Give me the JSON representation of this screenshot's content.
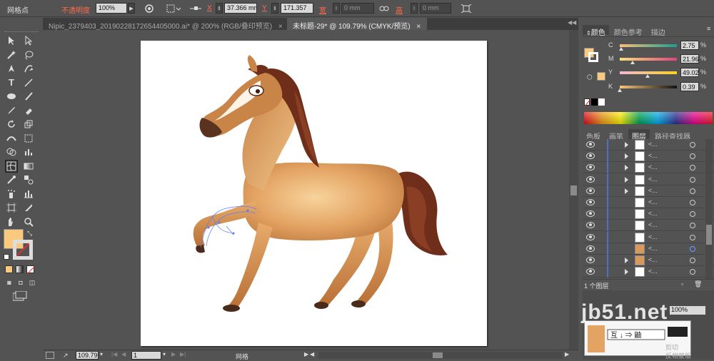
{
  "control_bar": {
    "tool_name": "网格点",
    "opacity_label": "不透明度",
    "opacity_value": "100%",
    "x_label": "X",
    "x_value": "37.366 mm",
    "y_label": "Y",
    "y_value": "171.357",
    "w_label": "宽",
    "w_value": "0 mm",
    "h_label": "高",
    "h_value": "0 mm"
  },
  "doc_tabs": [
    {
      "label": "Nipic_2379403_20190228172654405000.ai* @ 200% (RGB/叠印预览)",
      "close": "×"
    },
    {
      "label": "未标题-29* @ 109.79% (CMYK/预览)",
      "close": "×"
    }
  ],
  "status_bar": {
    "zoom": "109.79",
    "page": "1",
    "tool": "网格"
  },
  "color_panel": {
    "tabs": [
      "颜色",
      "颜色参考",
      "描边"
    ],
    "channels": [
      {
        "label": "C",
        "value": "2.75",
        "fraction": 0.0275,
        "grad_from": "#f7c07a",
        "grad_to": "#1f9e8f"
      },
      {
        "label": "M",
        "value": "21.96",
        "fraction": 0.2196,
        "grad_from": "#f9e07a",
        "grad_to": "#e0457b"
      },
      {
        "label": "Y",
        "value": "49.02",
        "fraction": 0.4902,
        "grad_from": "#f2b8d8",
        "grad_to": "#f7d51f"
      },
      {
        "label": "K",
        "value": "0.39",
        "fraction": 0.0039,
        "grad_from": "#f9c47d",
        "grad_to": "#111111"
      }
    ],
    "fill_color": "#f9c97d"
  },
  "layers_panel": {
    "tabs": [
      "色板",
      "画笔",
      "图层",
      "路径查找器"
    ],
    "row_name": "<...",
    "footer": "1 个图层"
  },
  "overlay_menu": {
    "item_1": "剪切",
    "item_2": "反相蒙版",
    "zoom_field": "100%"
  },
  "watermark": "jb51.net",
  "colors": {
    "ui_bg": "#535353",
    "accent_orange": "#f9c97d",
    "layer_blue": "#4b6ecf"
  }
}
